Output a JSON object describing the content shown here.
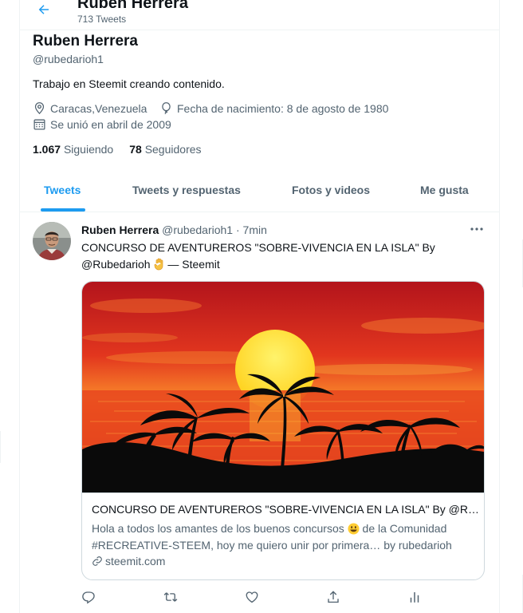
{
  "header": {
    "back_icon": "arrow-left-icon",
    "name": "Ruben Herrera",
    "tweet_count": "713 Tweets"
  },
  "profile": {
    "name": "Ruben Herrera",
    "handle": "@rubedarioh1",
    "bio": "Trabajo en Steemit creando contenido.",
    "location": "Caracas,Venezuela",
    "birthday": "Fecha de nacimiento: 8 de agosto de 1980",
    "joined": "Se unió en abril de 2009",
    "following_count": "1.067",
    "following_label": "Siguiendo",
    "followers_count": "78",
    "followers_label": "Seguidores"
  },
  "tabs": [
    {
      "label": "Tweets",
      "active": true
    },
    {
      "label": "Tweets y respuestas"
    },
    {
      "label": "Fotos y videos"
    },
    {
      "label": "Me gusta"
    }
  ],
  "tweet": {
    "author": "Ruben Herrera",
    "handle_time": "@rubedarioh1 · 7min",
    "text_line1": "CONCURSO DE AVENTUREROS \"SOBRE-VIVENCIA EN LA ISLA\" By",
    "text_mention": "@Rubedarioh",
    "text_suffix": " — Steemit",
    "card": {
      "title": "CONCURSO DE AVENTUREROS \"SOBRE-VIVENCIA EN LA ISLA\" By @R…",
      "desc_part1": "Hola a todos los amantes de los buenos concursos ",
      "desc_part2": " de la Comunidad #RECREATIVE-STEEM, hoy me quiero unir por primera… by rubedarioh",
      "domain": "steemit.com"
    },
    "actions": [
      "reply-icon",
      "retweet-icon",
      "like-icon",
      "share-icon",
      "analytics-icon"
    ]
  },
  "colors": {
    "accent": "#1d9bf0",
    "text": "#0f1419",
    "secondary": "#536471",
    "border": "#cfd9de"
  }
}
